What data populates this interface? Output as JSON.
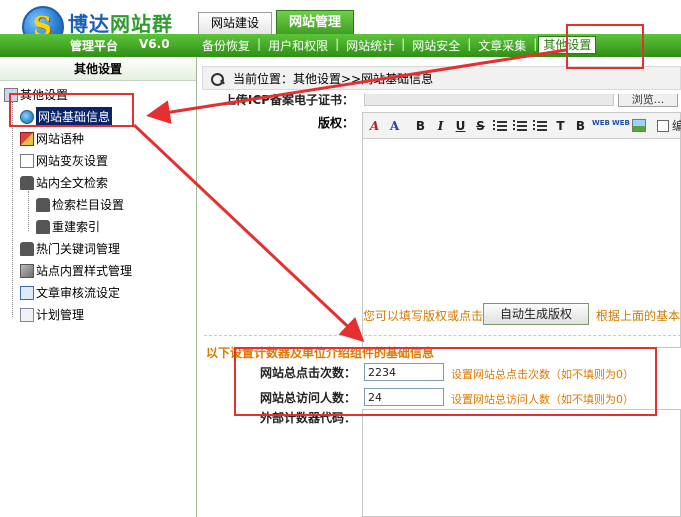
{
  "header": {
    "logo_glyph": "S",
    "title_part1": "博达",
    "title_part2": "网站群",
    "platform_label": "管理平台",
    "version": "V6.0",
    "top_tabs": [
      {
        "label": "网站建设",
        "active": false
      },
      {
        "label": "网站管理",
        "active": true
      }
    ],
    "nav_items": [
      {
        "label": "备份恢复"
      },
      {
        "label": "用户和权限"
      },
      {
        "label": "网站统计"
      },
      {
        "label": "网站安全"
      },
      {
        "label": "文章采集"
      },
      {
        "label": "其他设置",
        "active": true
      }
    ],
    "nav_separator": "|"
  },
  "sidebar": {
    "title": "其他设置",
    "items": [
      {
        "label": "其他设置",
        "icon": "computer-icon"
      },
      {
        "label": "网站基础信息",
        "icon": "globe-icon",
        "selected": true
      },
      {
        "label": "网站语种",
        "icon": "flag-icon"
      },
      {
        "label": "网站变灰设置",
        "icon": "page-icon"
      },
      {
        "label": "站内全文检索",
        "icon": "binoculars-icon"
      },
      {
        "label": "检索栏目设置",
        "icon": "binoculars-icon"
      },
      {
        "label": "重建索引",
        "icon": "binoculars-icon"
      },
      {
        "label": "热门关键词管理",
        "icon": "binoculars-icon"
      },
      {
        "label": "站点内置样式管理",
        "icon": "cube-icon"
      },
      {
        "label": "文章审核流设定",
        "icon": "review-icon"
      },
      {
        "label": "计划管理",
        "icon": "plan-icon"
      }
    ]
  },
  "main": {
    "breadcrumb": "当前位置：其他设置>>网站基础信息",
    "cert_label": "上传ICP备案电子证书：",
    "browse_label": "浏览...",
    "copyright_label": "版权：",
    "toolbar": {
      "font_color": "A",
      "font_bg": "A",
      "bold": "B",
      "italic": "I",
      "underline": "U",
      "strike": "S",
      "ts_label": "T",
      "b_label": "B",
      "link1": "WEB",
      "link2": "WEB",
      "tail": "编"
    },
    "autogen_hint": "您可以填写版权或点击",
    "autogen_button": "自动生成版权",
    "autogen_trail": "根据上面的基本",
    "counter_section_title": "以下设置计数器及单位介绍组件的基础信息",
    "clicks_label": "网站总点击次数：",
    "clicks_value": "2234",
    "clicks_hint": "设置网站总点击次数（如不填则为0）",
    "visitors_label": "网站总访问人数：",
    "visitors_value": "24",
    "visitors_hint": "设置网站总访问人数（如不填则为0）",
    "external_counter_label": "外部计数器代码："
  },
  "colors": {
    "brand_green": "#3c9a1f",
    "annotation_red": "#e53030",
    "hint_orange": "#e07800"
  }
}
